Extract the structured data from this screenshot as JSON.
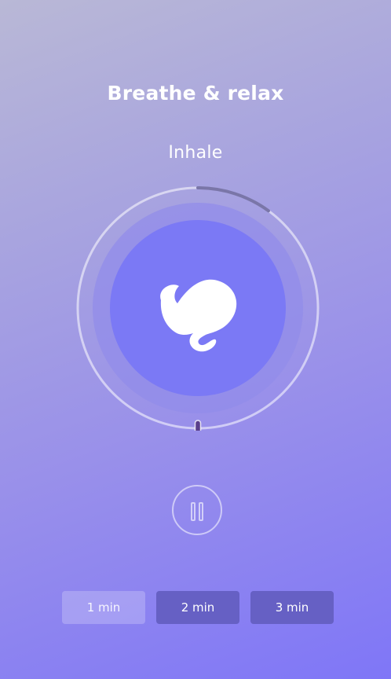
{
  "header": {
    "title": "Breathe & relax"
  },
  "session": {
    "phase": "Inhale",
    "progress": 0.1
  },
  "controls": {
    "pause_icon": "pause-icon"
  },
  "durations": {
    "options": [
      {
        "label": "1 min",
        "selected": true
      },
      {
        "label": "2 min",
        "selected": false
      },
      {
        "label": "3 min",
        "selected": false
      }
    ]
  },
  "colors": {
    "accent": "#7b79f5",
    "ring_mid": "#8c89ea",
    "button_dark": "#6660c4",
    "progress_arc": "#7a76a8",
    "indicator": "#5a3f8c"
  }
}
